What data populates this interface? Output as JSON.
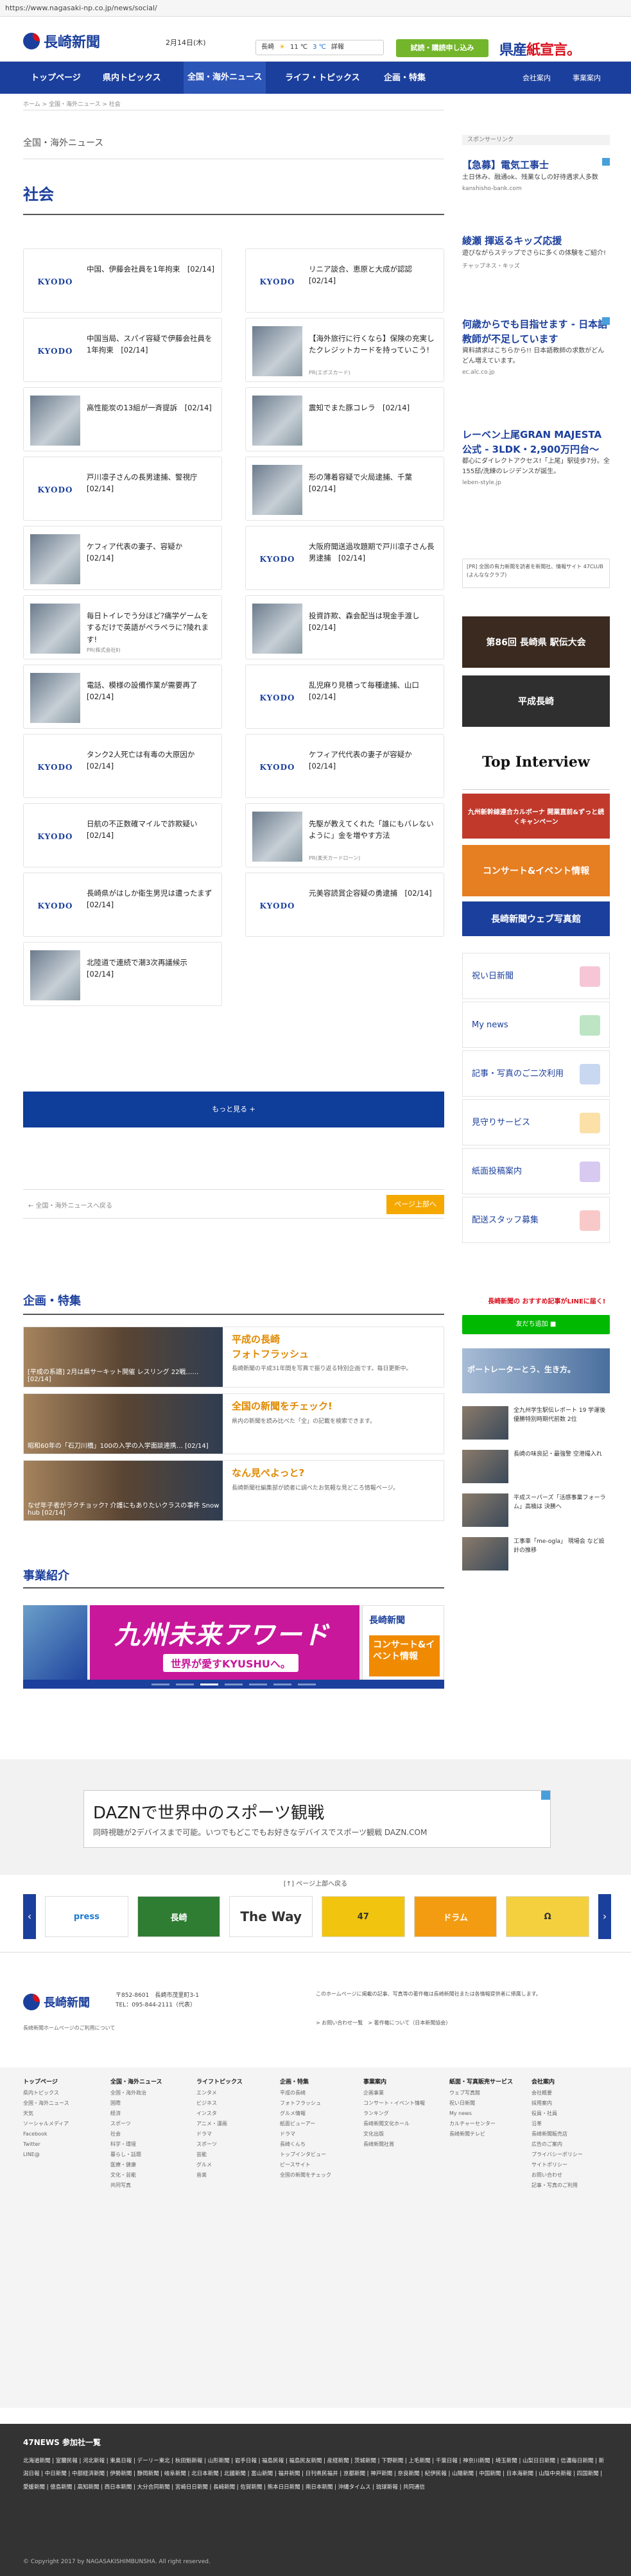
{
  "url": "https://www.nagasaki-np.co.jp/news/social/",
  "header": {
    "logo_text": "長崎新聞",
    "date": "2月14日(木)",
    "weather_city": "長崎",
    "weather_hi": "11 ℃",
    "weather_lo": "3 ℃",
    "weather_link": "詳報",
    "trial_button": "試読・購読申し込み",
    "slogan_main": "県産",
    "slogan_red": "紙宣言。"
  },
  "nav": {
    "items": [
      "トップページ",
      "県内トピックス",
      "全国・海外ニュース",
      "ライフ・トピックス",
      "企画・特集"
    ],
    "right": [
      "会社案内",
      "事業案内"
    ]
  },
  "breadcrumb": "ホーム > 全国・海外ニュース > 社会",
  "section": {
    "sub": "全国・海外ニュース",
    "title": "社会"
  },
  "articles_left": [
    {
      "title": "中国、伊藤会社員を1年拘束　[02/14]",
      "thumb": "KYODO"
    },
    {
      "title": "中国当局、スパイ容疑で伊藤会社員を1年拘束　[02/14]",
      "thumb": "KYODO"
    },
    {
      "title": "高性能炭の13組が一斉提訴　[02/14]",
      "thumb": "photo"
    },
    {
      "title": "戸川凛子さんの長男逮捕、警視庁　[02/14]",
      "thumb": "KYODO"
    },
    {
      "title": "ケフィア代表の妻子、容疑か　[02/14]",
      "thumb": "photo"
    },
    {
      "title": "毎日トイレでう分ほど?痛学ゲームをするだけで英語がペラペラに?陵れます!",
      "thumb": "photo",
      "pr": "PR(株式会社Ⅱ)"
    },
    {
      "title": "電話、模様の設備作業が需要再了　[02/14]",
      "thumb": "photo"
    },
    {
      "title": "タンク2人死亡は有毒の大原因か　[02/14]",
      "thumb": "KYODO"
    },
    {
      "title": "日航の不正数確マイルで詐欺疑い　[02/14]",
      "thumb": "KYODO"
    },
    {
      "title": "長崎県がはしか衛生男児は遭ったまず　[02/14]",
      "thumb": "KYODO"
    },
    {
      "title": "北陸道で連続で潮3次再議候示　[02/14]",
      "thumb": "photo"
    }
  ],
  "articles_right": [
    {
      "title": "リニア談合、恵原と大成が認認　[02/14]",
      "thumb": "KYODO"
    },
    {
      "title": "【海外旅行に行くなら】保険の充実したクレジットカードを持っていこう!",
      "thumb": "photo",
      "pr": "PR(エポスカード)"
    },
    {
      "title": "震知でまた豚コレラ　[02/14]",
      "thumb": "photo"
    },
    {
      "title": "形の薄着容疑で火局逮捕、千葉　[02/14]",
      "thumb": "photo"
    },
    {
      "title": "大阪府聞送過攻題期で戸川凛子さん長男逮捕　[02/14]",
      "thumb": "KYODO"
    },
    {
      "title": "投資詐欺、森会配当は現金手渡し　[02/14]",
      "thumb": "photo"
    },
    {
      "title": "乱児麻り見積って毎種逮捕、山口　[02/14]",
      "thumb": "KYODO"
    },
    {
      "title": "ケフィア代代表の妻子が容疑か　[02/14]",
      "thumb": "KYODO"
    },
    {
      "title": "先駆が教えてくれた「誰にもバレないように」金を増やす方法",
      "thumb": "photo",
      "pr": "PR(楽天カードローン)"
    },
    {
      "title": "元美容読賞企容疑の勇逮捕　[02/14]",
      "thumb": "KYODO"
    }
  ],
  "more_button": "もっと見る +",
  "back_link": "← 全国・海外ニュースへ戻る",
  "page_top": "ページ上部へ",
  "kikaku": {
    "title": "企画・特集",
    "items": [
      {
        "caption": "[平成の系譜] 2月は県サーキット開催 レスリング 22戦……　[02/14]",
        "head": "平成の長崎\nフォトフラッシュ",
        "desc": "長崎新聞の平成31年間を写真で振り返る特別企画です。毎日更新中。"
      },
      {
        "caption": "昭和60年の「石刀川橋」100の入学の入学面談連携… [02/14]",
        "head": "全国の新聞をチェック!",
        "desc": "県内の新聞を読み比べた「全」の記載を検索できます。"
      },
      {
        "caption": "なぜ年子者がラクチョック? 介護にもありたいクラスの事件 Snow hub [02/14]",
        "head": "なん見ぺよっと?",
        "desc": "長崎新聞社編集部が読者に調べたお気軽な見どころ情報ページ。"
      }
    ]
  },
  "business": {
    "title": "事業紹介",
    "banner_main": "九州未来アワード",
    "banner_sub": "世界が愛すKYUSHUへ。",
    "banner_right_title": "長崎新聞",
    "banner_right_tag": "コンサート&イベント情報"
  },
  "sponsored": {
    "label": "スポンサーリンク",
    "items": [
      {
        "title": "【急募】電気工事士",
        "desc": "土日休み、融通ok、残業なしの好待遇求人多数",
        "url": "kanshisho-bank.com"
      },
      {
        "title": "綾瀬 揮返るキッズ応援",
        "desc": "遊びながらステップでさらに多くの体験をご紹介!",
        "url": "チャップネス・キッズ"
      },
      {
        "title": "何歳からでも目指せます - 日本語教師が不足しています",
        "desc": "資料請求はこちらから!! 日本語教師の求数がどんどん増えています。",
        "url": "ec.alc.co.jp"
      },
      {
        "title": "レーベン上尾GRAN MAJESTA公式 - 3LDK・2,900万円台～",
        "desc": "都心にダイレクトアクセス!「上尾」駅徒歩7分。全155邸/洗練のレジデンスが誕生。",
        "url": "leben-style.jp"
      }
    ],
    "pr_note": "[PR] 全国の有力新聞を読者を新聞社、情報サイト 47CLUB (よんななクラブ)"
  },
  "side_banners": [
    "第86回 長崎県 駅伝大会",
    "平成長崎",
    "Top Interview",
    "九州新幹線連合カルボーナ 開業直前&ずっと続くキャンペーン",
    "コンサート&イベント情報",
    "長崎新聞ウェブ写真館"
  ],
  "services": [
    "祝い日新聞",
    "My news",
    "記事・写真のご二次利用",
    "見守りサービス",
    "紙面投稿案内",
    "配送スタッフ募集"
  ],
  "line_ad": {
    "text": "長崎新聞の\nおすすめ記事がLINEに届く!",
    "button": "友だち追加 ■"
  },
  "side_portrait": "ポートレーターとう、生き方。",
  "side_related": [
    {
      "text": "全九州学生駅伝レポート 19 学運後 優勝特別時期代前数 2位"
    },
    {
      "text": "長崎の味良記・最強警 空港撮入れ"
    },
    {
      "text": "平成スーパーズ「活感事業フォーラム」高橋は 決勝へ"
    },
    {
      "text": "工事車「me-ogla」 現場会 など設計の推移"
    }
  ],
  "dazn": {
    "head": "DAZNで世界中のスポーツ観戦",
    "sub": "同時視聴が2デバイスまで可能。いつでもどこでもお好きなデバイスでスポーツ観戦 DAZN.COM"
  },
  "pr_label": "[↑] ページ上部へ戻る",
  "strip": [
    "press",
    "長崎",
    "The Way",
    "47",
    "ドラム",
    "Ω"
  ],
  "footer": {
    "logo": "長崎新聞",
    "addr": "〒852-8601　長崎市茂里町3-1\nTEL：095-844-2111（代表）",
    "desc": "長崎新聞ホームページのご利用について",
    "note": "このホームページに掲載の記事、写真等の著作権は長崎新聞社または各情報提供者に帰属します。",
    "links": "> お問い合わせ一覧　> 著作権について（日本新聞協会）"
  },
  "sitemap": [
    {
      "hd": "トップページ",
      "items": [
        "県内トピックス",
        "全国・海外ニュース",
        "天気",
        "ソーシャルメディア",
        "Facebook",
        "Twitter",
        "LINE@"
      ]
    },
    {
      "hd": "全国・海外ニュース",
      "items": [
        "全国・海外政治",
        "国際",
        "経済",
        "スポーツ",
        "社会",
        "科学・環境",
        "暮らし・話題",
        "医療・健康",
        "文化・芸能",
        "共同写真"
      ]
    },
    {
      "hd": "ライフトピックス",
      "items": [
        "エンタメ",
        "ビジネス",
        "インスタ",
        "アニメ・漫画",
        "ドラマ",
        "スポーツ",
        "芸能",
        "グルメ",
        "音楽"
      ]
    },
    {
      "hd": "企画・特集",
      "items": [
        "平成の長崎",
        "フォトフラッシュ",
        "グルメ情報",
        "紙面ビューアー",
        "ドラマ",
        "長崎くんち",
        "トップインタビュー",
        "ピースサイト",
        "全国の新聞をチェック"
      ]
    },
    {
      "hd": "事業案内",
      "items": [
        "企画事業",
        "コンサート・イベント情報",
        "ランキング",
        "長崎新聞文化ホール",
        "文化出版",
        "長崎新聞社賞"
      ]
    },
    {
      "hd": "紙面・写真販売サービス",
      "items": [
        "ウェブ写真館",
        "祝い日新聞",
        "My news",
        "カルチャーセンター",
        "長崎新聞テレビ"
      ]
    },
    {
      "hd": "会社案内",
      "items": [
        "会社概要",
        "採用案内",
        "役員・社員",
        "沿革",
        "長崎新聞販売店",
        "広告のご案内",
        "プライバシーポリシー",
        "サイトポリシー",
        "お問い合わせ",
        "記事・写真のご利用"
      ]
    }
  ],
  "dark": {
    "head": "47NEWS 参加社一覧",
    "list": "北海道新聞 | 室蘭民報 | 河北新報 | 東奥日報 | デーリー東北 | 秋田魁新報 | 山形新聞 | 岩手日報 | 福島民報 | 福島民友新聞 | 産経新聞 | 茨城新聞 | 下野新聞 | 上毛新聞 | 千葉日報 | 神奈川新聞 | 埼玉新聞 | 山梨日日新聞 | 信濃毎日新聞 | 新潟日報 | 中日新聞 | 中部経済新聞 | 伊勢新聞 | 静岡新聞 | 岐阜新聞 | 北日本新聞 | 北國新聞 | 富山新聞 | 福井新聞 | 日刊県民福井 | 京都新聞 | 神戸新聞 | 奈良新聞 | 紀伊民報 | 山陽新聞 | 中国新聞 | 日本海新聞 | 山陰中央新報 | 四国新聞 | 愛媛新聞 | 徳島新聞 | 高知新聞 | 西日本新聞 | 大分合同新聞 | 宮崎日日新聞 | 長崎新聞 | 佐賀新聞 | 熊本日日新聞 | 南日本新聞 | 沖縄タイムス | 琉球新報 | 共同通信",
    "copy": "© Copyright 2017 by NAGASAKISHIMBUNSHA. All right reserved."
  }
}
